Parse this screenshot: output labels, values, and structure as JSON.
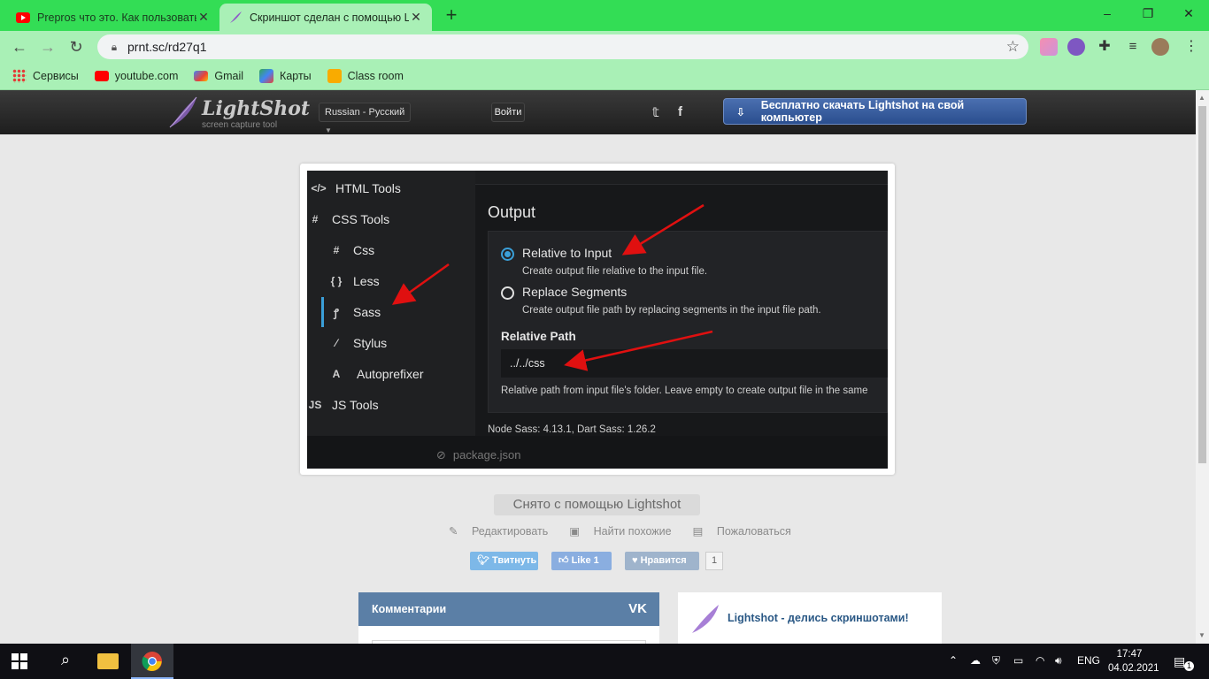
{
  "browser": {
    "tabs": [
      {
        "title": "Prepros что это. Как пользоваться",
        "active": false
      },
      {
        "title": "Скриншот сделан с помощью Lightshot",
        "active": true
      }
    ],
    "new_tab": "+",
    "url": "prnt.sc/rd27q1",
    "window_controls": {
      "minimize": "–",
      "maximize": "❐",
      "close": "✕"
    },
    "bookmarks": [
      {
        "label": "Сервисы",
        "icon": "apps-grid-icon"
      },
      {
        "label": "youtube.com",
        "icon": "youtube-icon"
      },
      {
        "label": "Gmail",
        "icon": "gmail-icon"
      },
      {
        "label": "Карты",
        "icon": "maps-icon"
      },
      {
        "label": "Class room",
        "icon": "classroom-icon"
      }
    ]
  },
  "lightshot": {
    "logo_name": "LightShot",
    "logo_tag": "screen capture tool",
    "language": "Russian - Русский",
    "login": "Войти",
    "download_label": "Бесплатно скачать Lightshot на свой компьютер",
    "caption": "Снято с помощью Lightshot",
    "actions": [
      "Редактировать",
      "Найти похожие",
      "Пожаловаться"
    ],
    "social": {
      "tweet": "Твитнуть",
      "like": "Like 1",
      "vk_like": "Нравится",
      "vk_count": "1"
    },
    "comments_title": "Комментарии",
    "comments_vk": "VK",
    "promo_text": "Lightshot - делись скриншотами!"
  },
  "screenshot": {
    "sidebar": [
      {
        "icon": "</>",
        "label": "HTML Tools"
      },
      {
        "icon": "#",
        "label": "CSS Tools"
      },
      {
        "icon": "#",
        "label": "Css"
      },
      {
        "icon": "{ }",
        "label": "Less"
      },
      {
        "icon": "ꝭ",
        "label": "Sass"
      },
      {
        "icon": "⁄",
        "label": "Stylus"
      },
      {
        "icon": "A",
        "label": "Autoprefixer"
      },
      {
        "icon": "JS",
        "label": "JS Tools"
      }
    ],
    "output_heading": "Output",
    "option1_label": "Relative to Input",
    "option1_desc": "Create output file relative to the input file.",
    "option2_label": "Replace Segments",
    "option2_desc": "Create output file path by replacing segments in the input file path.",
    "relative_path_label": "Relative Path",
    "relative_path_value": "../../css",
    "relative_path_help": "Relative path from input file's folder. Leave empty to create output file in the same",
    "version_line": "Node Sass: 4.13.1, Dart Sass: 1.26.2",
    "bottom_file": "package.json"
  },
  "taskbar": {
    "language": "ENG",
    "time": "17:47",
    "date": "04.02.2021",
    "notification_count": "1"
  },
  "colors": {
    "tab_strip": "#33dd55",
    "toolbar": "#a9f0b6",
    "accent_blue": "#3a9fd8",
    "arrow_red": "#e01010"
  }
}
